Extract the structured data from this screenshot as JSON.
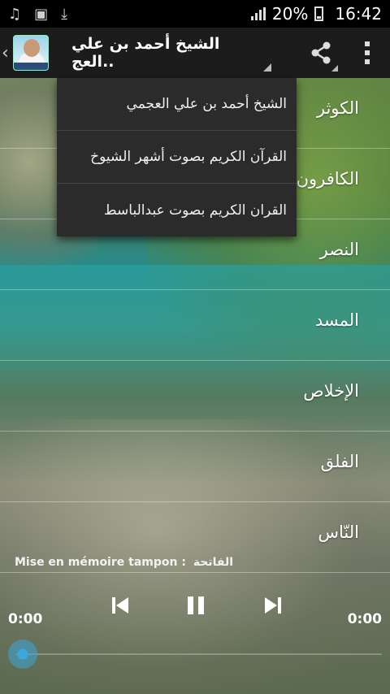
{
  "status_bar": {
    "battery_percent": "20%",
    "time": "16:42",
    "notification_icons": [
      "music-icon",
      "image-icon",
      "download-icon"
    ]
  },
  "action_bar": {
    "spinner_title": "الشيخ أحمد بن علي العج..",
    "icons": [
      "back-chevron-icon",
      "app-icon",
      "share-icon",
      "overflow-menu-icon"
    ]
  },
  "dropdown": {
    "items": [
      "الشيخ أحمد بن علي العجمي",
      "القرآن الكريم بصوت أشهر الشيوخ",
      "القران الكريم بصوت عبدالباسط"
    ]
  },
  "surahs": [
    "الكوثر",
    "الكافرون",
    "النصر",
    "المسد",
    "الإخلاص",
    "الفلق",
    "النّاس"
  ],
  "player": {
    "buffer_label": "Mise en mémoire tampon :",
    "buffer_surah": "الفاتحة",
    "elapsed": "0:00",
    "duration": "0:00",
    "progress": 0,
    "controls": [
      "previous-icon",
      "pause-icon",
      "next-icon"
    ]
  },
  "colors": {
    "accent": "#3aa8dc",
    "action_bar": "#1c1c1c",
    "menu": "#2b2b2b"
  }
}
